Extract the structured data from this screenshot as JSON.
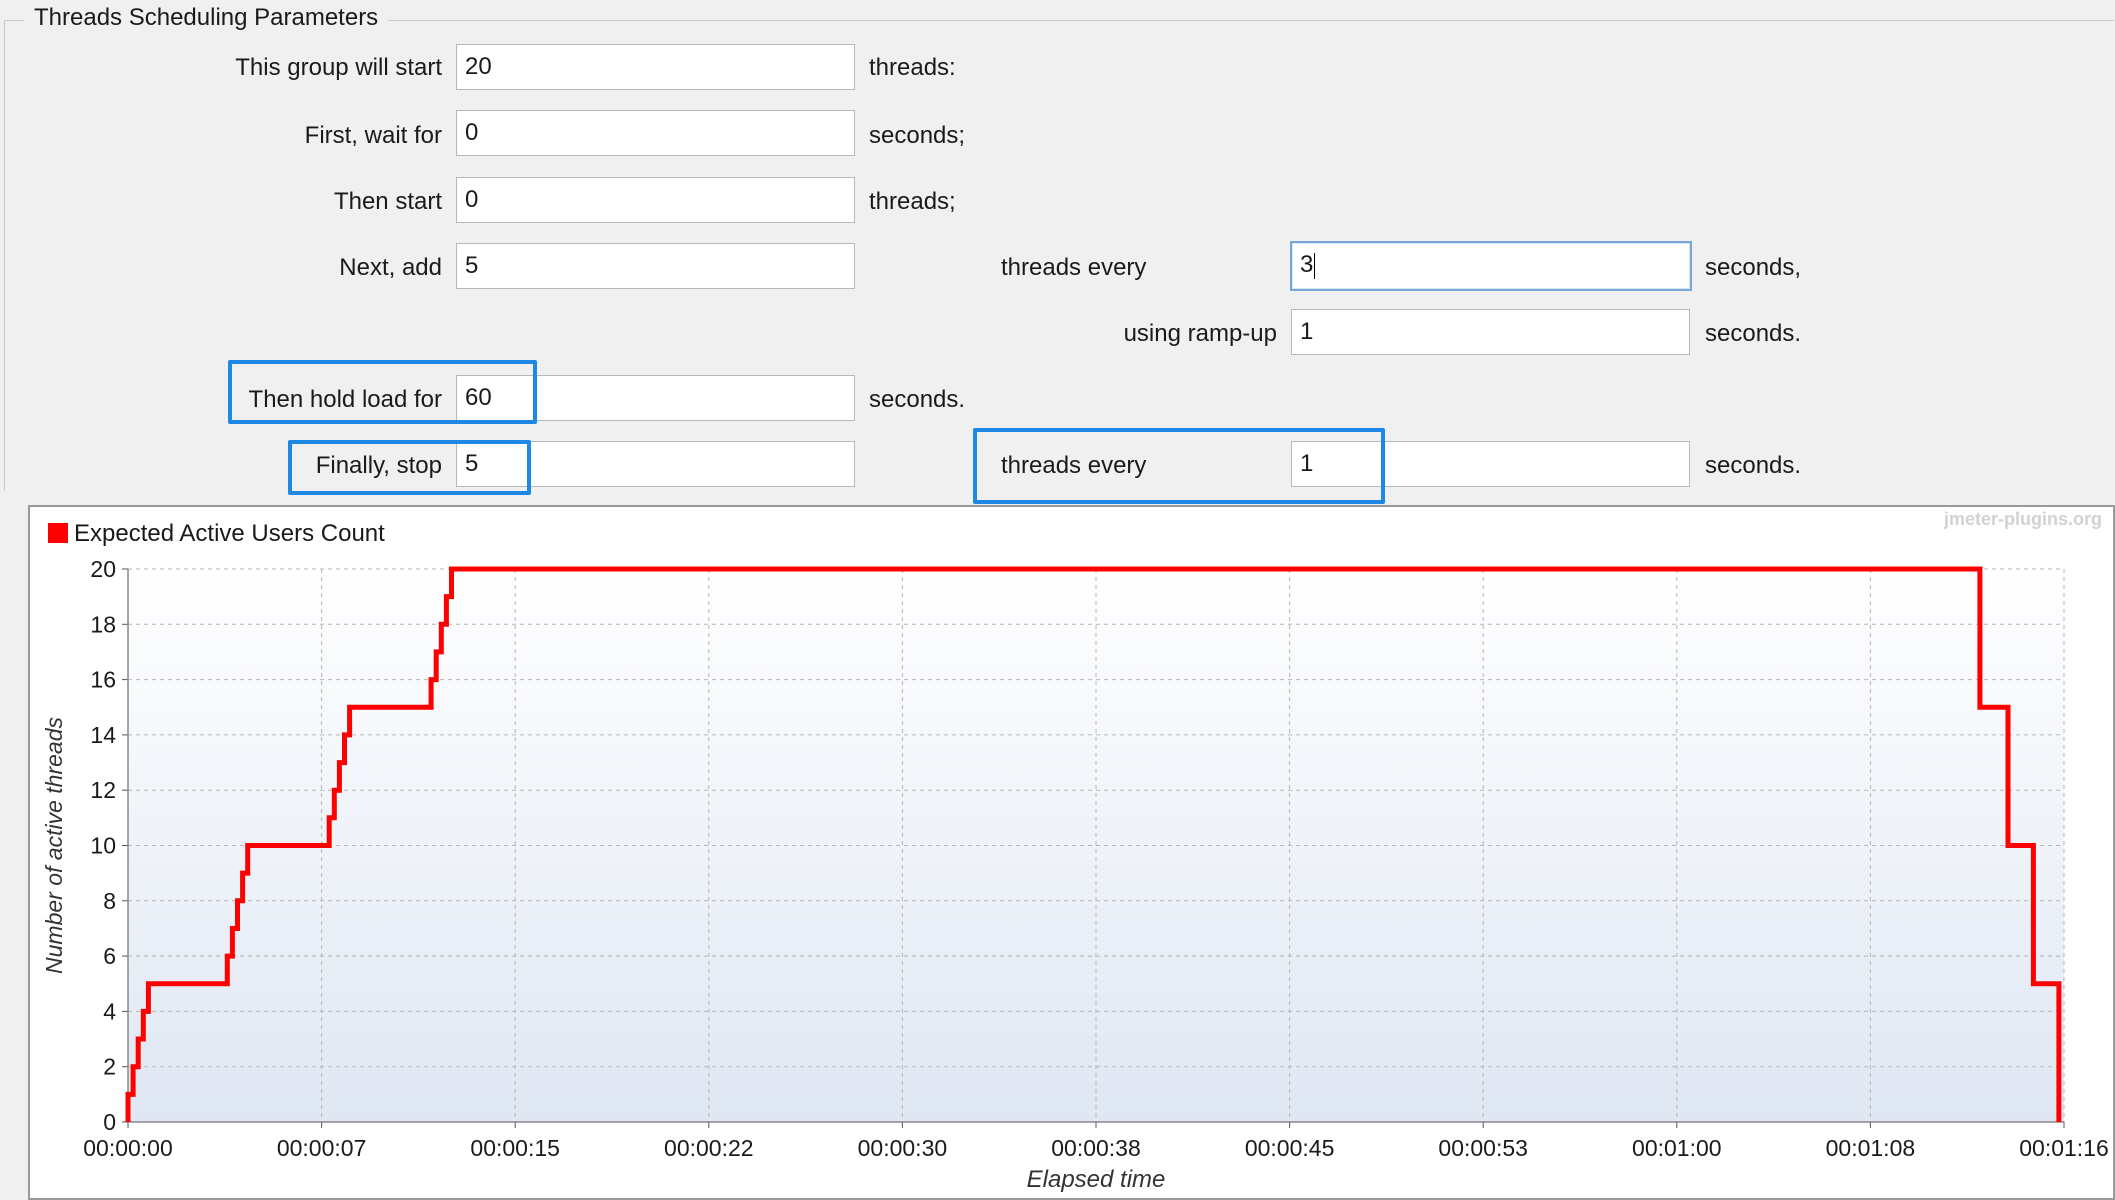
{
  "section_title": "Threads Scheduling Parameters",
  "form": {
    "start_label": "This group will start",
    "start_value": "20",
    "start_unit": "threads:",
    "wait_label": "First, wait for",
    "wait_value": "0",
    "wait_unit": "seconds;",
    "then_start_label": "Then start",
    "then_start_value": "0",
    "then_start_unit": "threads;",
    "next_add_label": "Next, add",
    "next_add_value": "5",
    "threads_every_label": "threads every",
    "threads_every_value": "3",
    "threads_every_unit": "seconds,",
    "rampup_label": "using ramp-up",
    "rampup_value": "1",
    "rampup_unit": "seconds.",
    "hold_label": "Then hold load for",
    "hold_value": "60",
    "hold_unit": "seconds.",
    "stop_label": "Finally, stop",
    "stop_value": "5",
    "stop_every_label": "threads every",
    "stop_every_value": "1",
    "stop_every_unit": "seconds."
  },
  "colors": {
    "highlight": "#1e88e5",
    "series": "#ff0000"
  },
  "chart_data": {
    "type": "line",
    "watermark": "jmeter-plugins.org",
    "legend": "Expected Active Users Count",
    "ylabel": "Number of active threads",
    "xlabel": "Elapsed time",
    "xlim": [
      0,
      76
    ],
    "ylim": [
      0,
      20
    ],
    "x_ticks": [
      0,
      7.6,
      15.2,
      22.8,
      30.4,
      38,
      45.6,
      53.2,
      60.8,
      68.4,
      76
    ],
    "x_tick_labels": [
      "00:00:00",
      "00:00:07",
      "00:00:15",
      "00:00:22",
      "00:00:30",
      "00:00:38",
      "00:00:45",
      "00:00:53",
      "00:01:00",
      "00:01:08",
      "00:01:16"
    ],
    "y_ticks": [
      0,
      2,
      4,
      6,
      8,
      10,
      12,
      14,
      16,
      18,
      20
    ],
    "y_tick_labels": [
      "0",
      "2",
      "4",
      "6",
      "8",
      "10",
      "12",
      "14",
      "16",
      "18",
      "20"
    ],
    "series": [
      {
        "name": "Expected Active Users Count",
        "color": "#ff0000",
        "points": [
          [
            0,
            0
          ],
          [
            0,
            1
          ],
          [
            0.2,
            1
          ],
          [
            0.2,
            2
          ],
          [
            0.4,
            2
          ],
          [
            0.4,
            3
          ],
          [
            0.6,
            3
          ],
          [
            0.6,
            4
          ],
          [
            0.8,
            4
          ],
          [
            0.8,
            5
          ],
          [
            3.9,
            5
          ],
          [
            3.9,
            6
          ],
          [
            4.1,
            6
          ],
          [
            4.1,
            7
          ],
          [
            4.3,
            7
          ],
          [
            4.3,
            8
          ],
          [
            4.5,
            8
          ],
          [
            4.5,
            9
          ],
          [
            4.7,
            9
          ],
          [
            4.7,
            10
          ],
          [
            7.9,
            10
          ],
          [
            7.9,
            11
          ],
          [
            8.1,
            11
          ],
          [
            8.1,
            12
          ],
          [
            8.3,
            12
          ],
          [
            8.3,
            13
          ],
          [
            8.5,
            13
          ],
          [
            8.5,
            14
          ],
          [
            8.7,
            14
          ],
          [
            8.7,
            15
          ],
          [
            11.9,
            15
          ],
          [
            11.9,
            16
          ],
          [
            12.1,
            16
          ],
          [
            12.1,
            17
          ],
          [
            12.3,
            17
          ],
          [
            12.3,
            18
          ],
          [
            12.5,
            18
          ],
          [
            12.5,
            19
          ],
          [
            12.7,
            19
          ],
          [
            12.7,
            20
          ],
          [
            72.7,
            20
          ],
          [
            72.7,
            15
          ],
          [
            73.8,
            15
          ],
          [
            73.8,
            10
          ],
          [
            74.8,
            10
          ],
          [
            74.8,
            5
          ],
          [
            75.8,
            5
          ],
          [
            75.8,
            0
          ]
        ]
      }
    ]
  }
}
